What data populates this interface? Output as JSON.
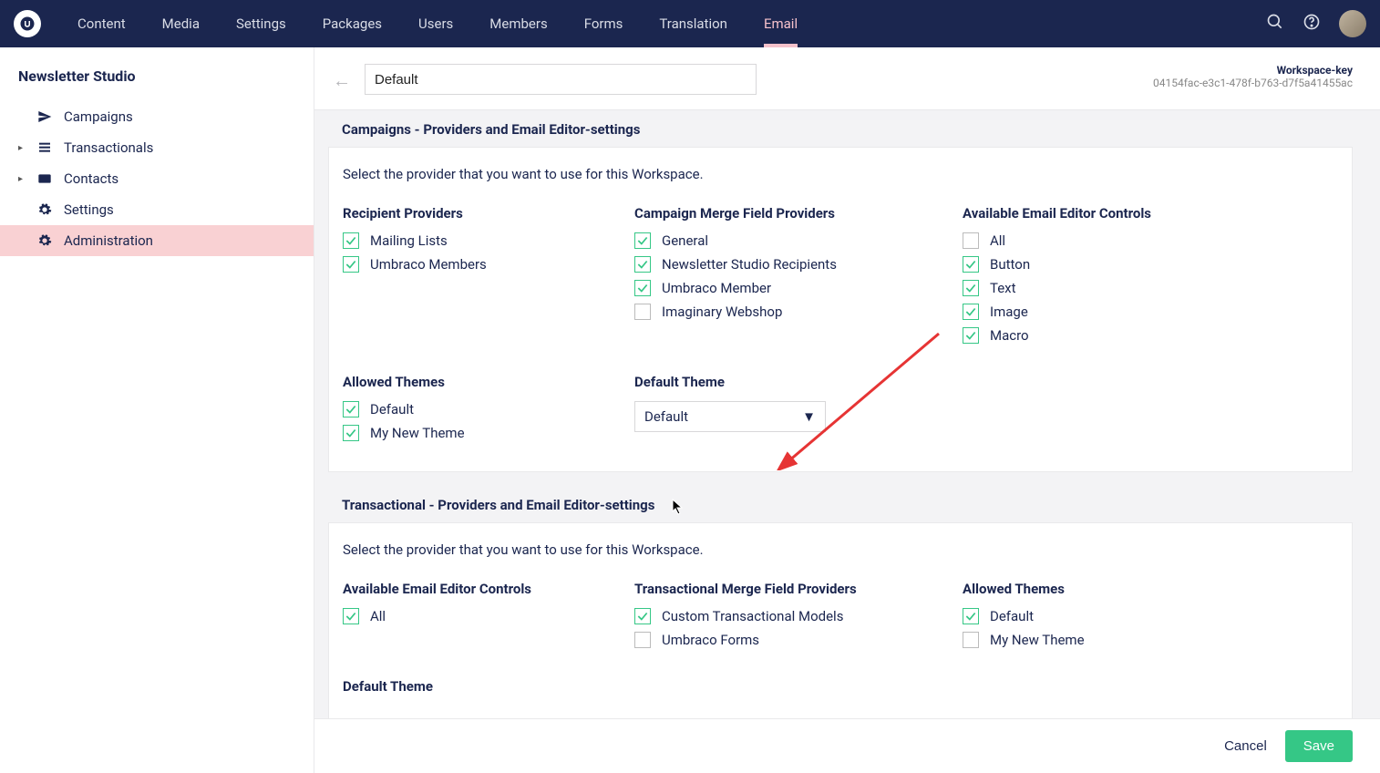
{
  "topnav": {
    "items": [
      "Content",
      "Media",
      "Settings",
      "Packages",
      "Users",
      "Members",
      "Forms",
      "Translation",
      "Email"
    ],
    "active": "Email"
  },
  "sidebar": {
    "title": "Newsletter Studio",
    "items": [
      {
        "label": "Campaigns",
        "icon": "send",
        "expandable": false
      },
      {
        "label": "Transactionals",
        "icon": "list",
        "expandable": true
      },
      {
        "label": "Contacts",
        "icon": "card",
        "expandable": true
      },
      {
        "label": "Settings",
        "icon": "gear",
        "expandable": false
      },
      {
        "label": "Administration",
        "icon": "gear",
        "expandable": false,
        "active": true
      }
    ]
  },
  "header": {
    "title_value": "Default",
    "workspace_key_label": "Workspace-key",
    "workspace_key_value": "04154fac-e3c1-478f-b763-d7f5a41455ac"
  },
  "campaigns": {
    "section_title": "Campaigns - Providers and Email Editor-settings",
    "description": "Select the provider that you want to use for this Workspace.",
    "recipient_providers": {
      "title": "Recipient Providers",
      "items": [
        {
          "label": "Mailing Lists",
          "checked": true
        },
        {
          "label": "Umbraco Members",
          "checked": true
        }
      ]
    },
    "merge_field_providers": {
      "title": "Campaign Merge Field Providers",
      "items": [
        {
          "label": "General",
          "checked": true
        },
        {
          "label": "Newsletter Studio Recipients",
          "checked": true
        },
        {
          "label": "Umbraco Member",
          "checked": true
        },
        {
          "label": "Imaginary Webshop",
          "checked": false
        }
      ]
    },
    "editor_controls": {
      "title": "Available Email Editor Controls",
      "items": [
        {
          "label": "All",
          "checked": false
        },
        {
          "label": "Button",
          "checked": true
        },
        {
          "label": "Text",
          "checked": true
        },
        {
          "label": "Image",
          "checked": true
        },
        {
          "label": "Macro",
          "checked": true
        }
      ]
    },
    "allowed_themes": {
      "title": "Allowed Themes",
      "items": [
        {
          "label": "Default",
          "checked": true
        },
        {
          "label": "My New Theme",
          "checked": true
        }
      ]
    },
    "default_theme": {
      "title": "Default Theme",
      "selected": "Default"
    }
  },
  "transactional": {
    "section_title": "Transactional - Providers and Email Editor-settings",
    "description": "Select the provider that you want to use for this Workspace.",
    "editor_controls": {
      "title": "Available Email Editor Controls",
      "items": [
        {
          "label": "All",
          "checked": true
        }
      ]
    },
    "merge_field_providers": {
      "title": "Transactional Merge Field Providers",
      "items": [
        {
          "label": "Custom Transactional Models",
          "checked": true
        },
        {
          "label": "Umbraco Forms",
          "checked": false
        }
      ]
    },
    "allowed_themes": {
      "title": "Allowed Themes",
      "items": [
        {
          "label": "Default",
          "checked": true
        },
        {
          "label": "My New Theme",
          "checked": false
        }
      ]
    },
    "default_theme": {
      "title": "Default Theme"
    }
  },
  "footer": {
    "cancel": "Cancel",
    "save": "Save"
  }
}
